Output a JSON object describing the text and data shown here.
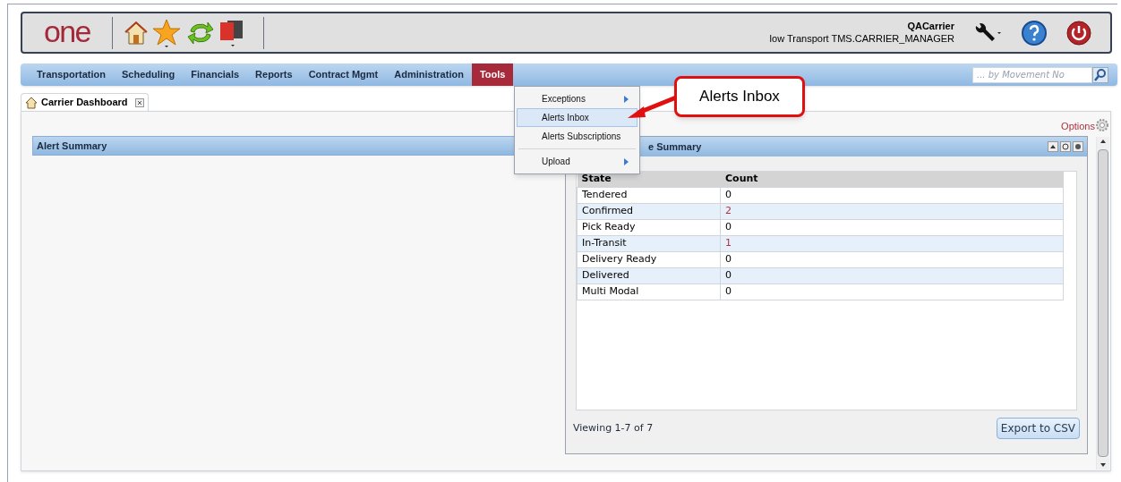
{
  "header": {
    "logo": "one",
    "user": "QACarrier",
    "role": "low Transport TMS.CARRIER_MANAGER"
  },
  "nav": [
    {
      "label": "Transportation",
      "selected": false
    },
    {
      "label": "Scheduling",
      "selected": false
    },
    {
      "label": "Financials",
      "selected": false
    },
    {
      "label": "Reports",
      "selected": false
    },
    {
      "label": "Contract Mgmt",
      "selected": false
    },
    {
      "label": "Administration",
      "selected": false
    },
    {
      "label": "Tools",
      "selected": true
    }
  ],
  "search": {
    "placeholder": "... by Movement No"
  },
  "tabs": [
    {
      "label": "Carrier Dashboard",
      "selected": true
    }
  ],
  "options_link": "Options",
  "menu": [
    {
      "label": "Exceptions",
      "submenu": true,
      "selected": false
    },
    {
      "label": "Alerts Inbox",
      "submenu": false,
      "selected": true
    },
    {
      "label": "Alerts Subscriptions",
      "submenu": false,
      "selected": false
    },
    {
      "label": "Upload",
      "submenu": true,
      "selected": false
    }
  ],
  "callout": "Alerts Inbox",
  "alert_panel": {
    "title": "Alert Summary"
  },
  "state_panel": {
    "title": "e Summary",
    "table": {
      "columns": [
        "State",
        "Count"
      ],
      "rows": [
        {
          "state": "Tendered",
          "count": "0",
          "highlighted": false
        },
        {
          "state": "Confirmed",
          "count": "2",
          "highlighted": true
        },
        {
          "state": "Pick Ready",
          "count": "0",
          "highlighted": false
        },
        {
          "state": "In-Transit",
          "count": "1",
          "highlighted": true
        },
        {
          "state": "Delivery Ready",
          "count": "0",
          "highlighted": false
        },
        {
          "state": "Delivered",
          "count": "0",
          "highlighted": false
        },
        {
          "state": "Multi Modal",
          "count": "0",
          "highlighted": false
        }
      ]
    },
    "footer": "Viewing 1-7 of 7",
    "export_button": "Export to CSV"
  }
}
